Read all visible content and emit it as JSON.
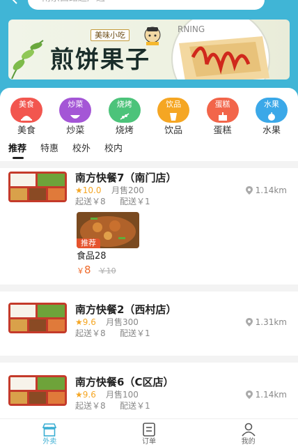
{
  "header": {
    "search_placeholder": "南京西路超产遇"
  },
  "banner": {
    "tag": "美味小吃",
    "title": "煎饼果子",
    "plate_text": "RNING"
  },
  "categories": [
    {
      "label": "美食",
      "bubble": "美食",
      "color": "#f2564f"
    },
    {
      "label": "炒菜",
      "bubble": "炒菜",
      "color": "#a456d6"
    },
    {
      "label": "烧烤",
      "bubble": "烧烤",
      "color": "#4cc37a"
    },
    {
      "label": "饮品",
      "bubble": "饮品",
      "color": "#f5a623"
    },
    {
      "label": "蛋糕",
      "bubble": "蛋糕",
      "color": "#f2654a"
    },
    {
      "label": "水果",
      "bubble": "水果",
      "color": "#3ba8e8"
    }
  ],
  "tabs": [
    "推荐",
    "特惠",
    "校外",
    "校内"
  ],
  "shops": [
    {
      "name": "南方快餐7（南门店）",
      "rating": "★10.0",
      "sales": "月售200",
      "min_order": "起送￥8",
      "delivery": "配送￥1",
      "distance": "1.14km",
      "dish": {
        "badge": "推荐",
        "name": "食品28",
        "currency": "￥",
        "price": "8",
        "old_price": "￥10"
      }
    },
    {
      "name": "南方快餐2（西村店）",
      "rating": "★9.6",
      "sales": "月售300",
      "min_order": "起送￥8",
      "delivery": "配送￥1",
      "distance": "1.31km"
    },
    {
      "name": "南方快餐6（C区店）",
      "rating": "★9.6",
      "sales": "月售100",
      "min_order": "起送￥8",
      "delivery": "配送￥1",
      "distance": "1.14km"
    }
  ],
  "nav": [
    {
      "label": "外卖",
      "icon": "store-icon",
      "active": true
    },
    {
      "label": "订单",
      "icon": "orders-icon",
      "active": false
    },
    {
      "label": "我的",
      "icon": "profile-icon",
      "active": false
    }
  ],
  "colors": {
    "accent": "#3aaed3",
    "price": "#ef6a2b",
    "rating": "#f5a623"
  }
}
